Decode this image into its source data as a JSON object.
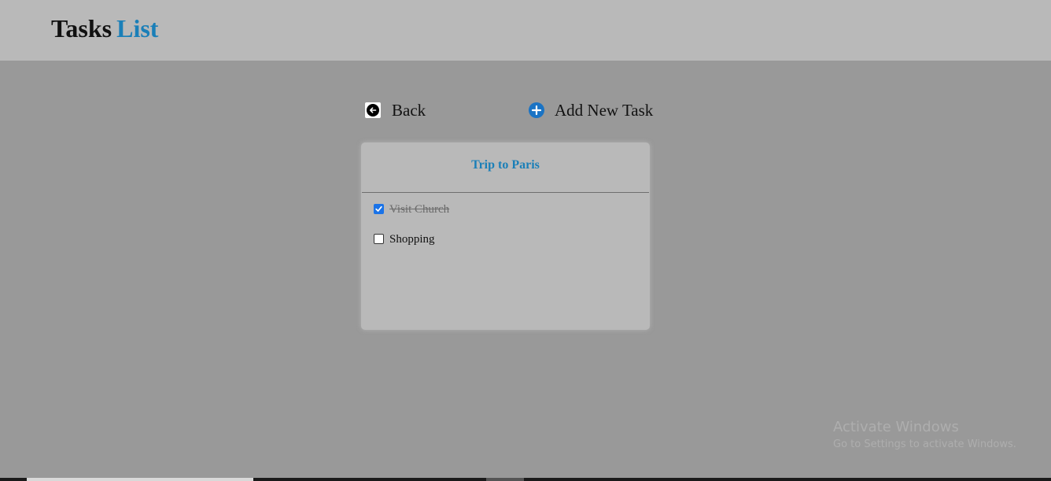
{
  "header": {
    "brand_word_1": "Tasks",
    "brand_word_2": "List",
    "brand_color_1": "#111111",
    "brand_color_2": "#1a7fb8"
  },
  "actions": {
    "back_label": "Back",
    "back_icon": "arrow-left-circle-icon",
    "add_label": "Add New Task",
    "add_icon": "plus-circle-icon"
  },
  "list": {
    "title": "Trip to Paris",
    "tasks": [
      {
        "label": "Visit Church",
        "checked": true
      },
      {
        "label": "Shopping",
        "checked": false
      }
    ]
  },
  "watermark": {
    "title": "Activate Windows",
    "subtitle": "Go to Settings to activate Windows."
  },
  "colors": {
    "accent": "#1a7fb8",
    "checkbox_checked": "#1a73e8",
    "overlay_background": "#999999",
    "header_background": "#b9b9b9"
  }
}
